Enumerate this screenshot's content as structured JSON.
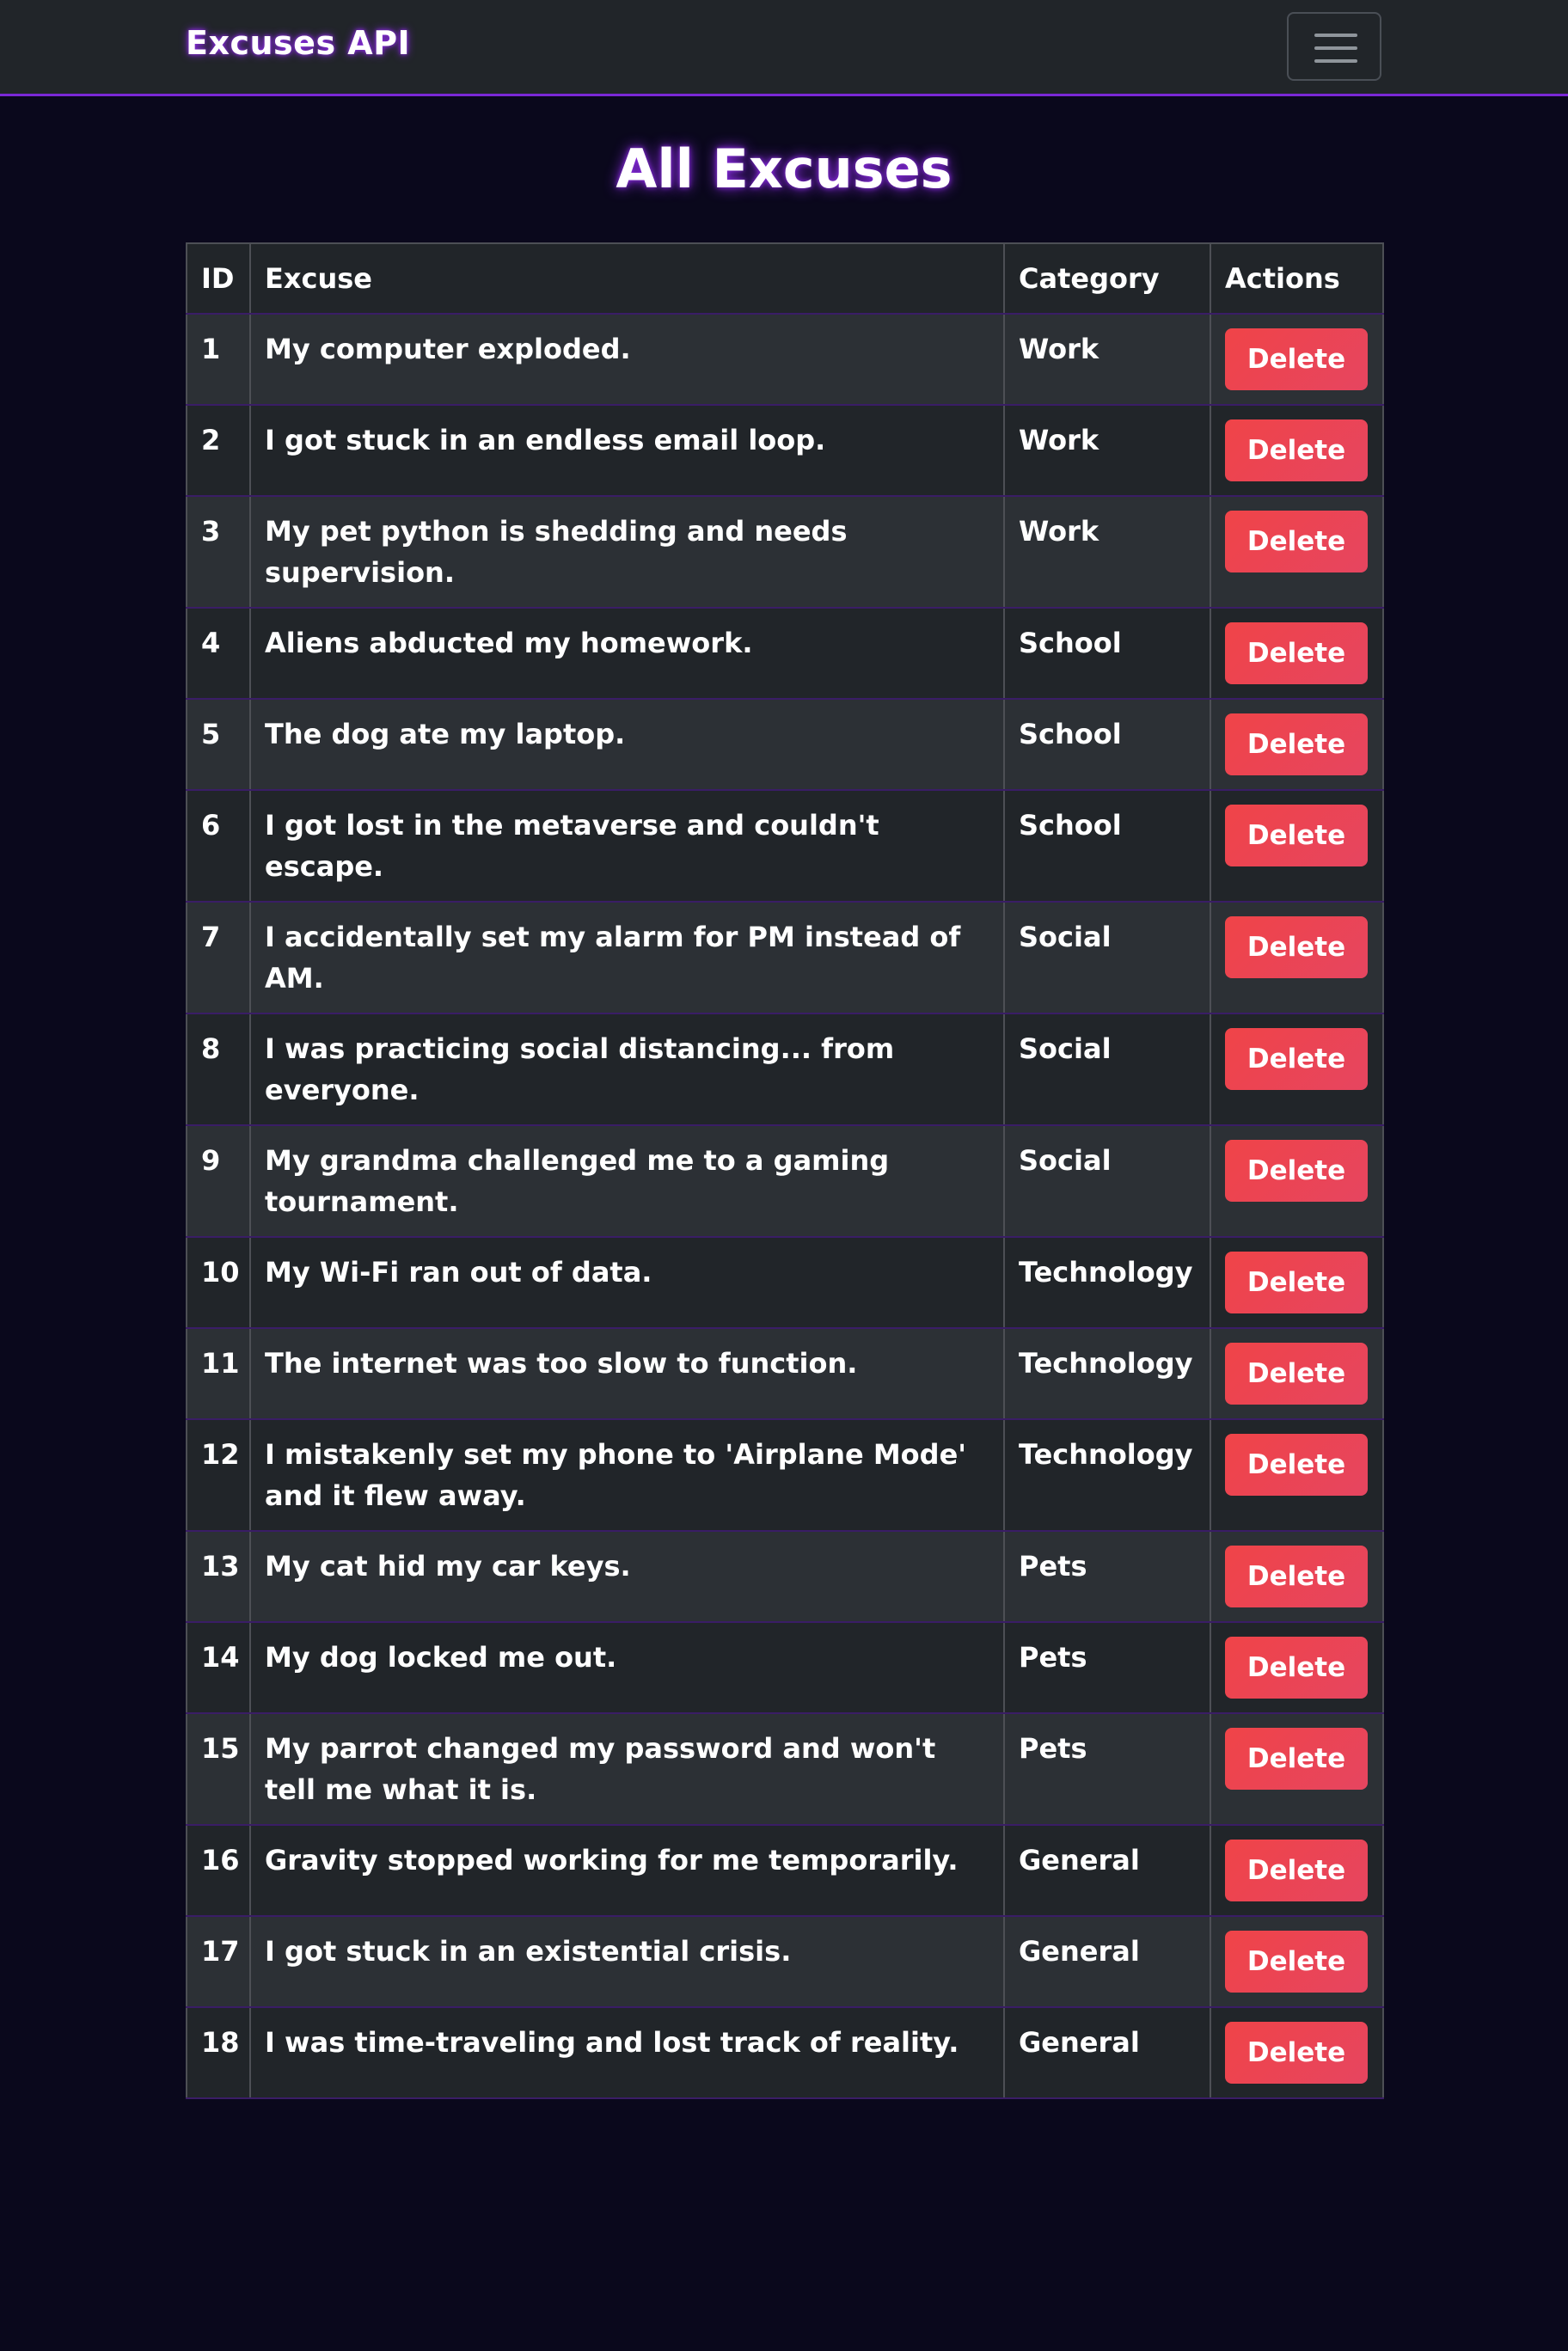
{
  "navbar": {
    "brand": "Excuses API",
    "toggler_icon": "hamburger-menu-icon"
  },
  "page": {
    "title": "All Excuses"
  },
  "table": {
    "headers": {
      "id": "ID",
      "excuse": "Excuse",
      "category": "Category",
      "actions": "Actions"
    },
    "delete_label": "Delete",
    "rows": [
      {
        "id": "1",
        "excuse": "My computer exploded.",
        "category": "Work"
      },
      {
        "id": "2",
        "excuse": "I got stuck in an endless email loop.",
        "category": "Work"
      },
      {
        "id": "3",
        "excuse": "My pet python is shedding and needs supervision.",
        "category": "Work"
      },
      {
        "id": "4",
        "excuse": "Aliens abducted my homework.",
        "category": "School"
      },
      {
        "id": "5",
        "excuse": "The dog ate my laptop.",
        "category": "School"
      },
      {
        "id": "6",
        "excuse": "I got lost in the metaverse and couldn't escape.",
        "category": "School"
      },
      {
        "id": "7",
        "excuse": "I accidentally set my alarm for PM instead of AM.",
        "category": "Social"
      },
      {
        "id": "8",
        "excuse": "I was practicing social distancing... from everyone.",
        "category": "Social"
      },
      {
        "id": "9",
        "excuse": "My grandma challenged me to a gaming tournament.",
        "category": "Social"
      },
      {
        "id": "10",
        "excuse": "My Wi-Fi ran out of data.",
        "category": "Technology"
      },
      {
        "id": "11",
        "excuse": "The internet was too slow to function.",
        "category": "Technology"
      },
      {
        "id": "12",
        "excuse": "I mistakenly set my phone to 'Airplane Mode' and it flew away.",
        "category": "Technology"
      },
      {
        "id": "13",
        "excuse": "My cat hid my car keys.",
        "category": "Pets"
      },
      {
        "id": "14",
        "excuse": "My dog locked me out.",
        "category": "Pets"
      },
      {
        "id": "15",
        "excuse": "My parrot changed my password and won't tell me what it is.",
        "category": "Pets"
      },
      {
        "id": "16",
        "excuse": "Gravity stopped working for me temporarily.",
        "category": "General"
      },
      {
        "id": "17",
        "excuse": "I got stuck in an existential crisis.",
        "category": "General"
      },
      {
        "id": "18",
        "excuse": "I was time-traveling and lost track of reality.",
        "category": "General"
      }
    ]
  },
  "colors": {
    "background": "#0a081c",
    "navbar": "#212529",
    "accent": "#7a28d6",
    "delete_button": "#e84a5a"
  }
}
